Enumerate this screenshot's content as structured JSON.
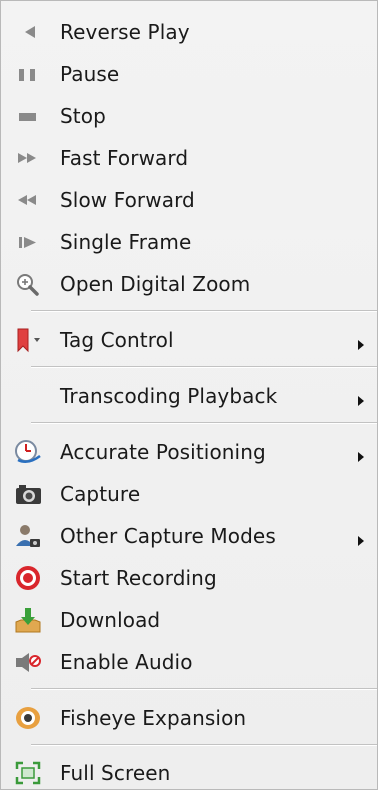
{
  "menu": {
    "items": [
      {
        "label": "Reverse Play",
        "icon": "reverse-play-icon"
      },
      {
        "label": "Pause",
        "icon": "pause-icon"
      },
      {
        "label": "Stop",
        "icon": "stop-icon"
      },
      {
        "label": "Fast Forward",
        "icon": "fast-forward-icon"
      },
      {
        "label": "Slow Forward",
        "icon": "slow-forward-icon"
      },
      {
        "label": "Single Frame",
        "icon": "single-frame-icon"
      },
      {
        "label": "Open Digital Zoom",
        "icon": "zoom-icon"
      },
      {
        "label": "Tag Control",
        "icon": "bookmark-tag-icon",
        "submenu": true
      },
      {
        "label": "Transcoding Playback",
        "submenu": true
      },
      {
        "label": "Accurate Positioning",
        "icon": "clock-icon",
        "submenu": true
      },
      {
        "label": "Capture",
        "icon": "camera-icon"
      },
      {
        "label": "Other Capture Modes",
        "icon": "user-capture-icon",
        "submenu": true
      },
      {
        "label": "Start Recording",
        "icon": "record-icon"
      },
      {
        "label": "Download",
        "icon": "download-icon"
      },
      {
        "label": "Enable Audio",
        "icon": "audio-muted-icon"
      },
      {
        "label": "Fisheye Expansion",
        "icon": "fisheye-icon"
      },
      {
        "label": "Full Screen",
        "icon": "fullscreen-icon"
      }
    ]
  },
  "colors": {
    "menu_background": "#f0f0f0",
    "separator": "#c2c2c2",
    "icon_gray": "#8a8a8a",
    "record_red": "#d9262c",
    "tag_red": "#e04040",
    "download_green": "#3aa03a",
    "fullscreen_green": "#3a9a3a"
  }
}
